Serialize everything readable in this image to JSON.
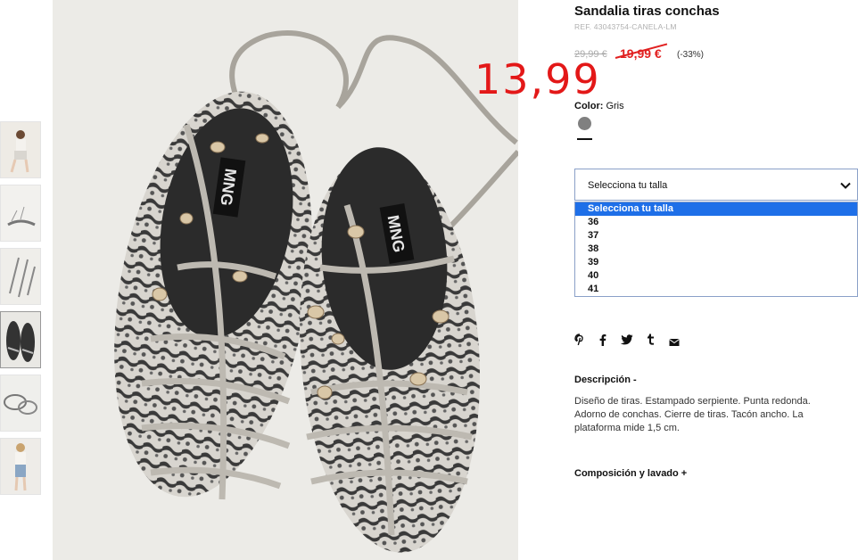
{
  "product": {
    "title": "Sandalia tiras conchas",
    "ref": "REF. 43043754-CANELA-LM",
    "old_price": "29,99 €",
    "sale_price": "19,99 €",
    "discount": "(-33%)",
    "handwritten_price": "13,99",
    "color_label": "Color:",
    "color_value": "Gris",
    "swatch_color": "#808080",
    "sale_color": "#e12020"
  },
  "size_select": {
    "label": "Selecciona tu talla",
    "options": [
      "Selecciona tu talla",
      "36",
      "37",
      "38",
      "39",
      "40",
      "41"
    ],
    "selected_index": 0
  },
  "share_icons": [
    "pinterest-icon",
    "facebook-icon",
    "twitter-icon",
    "tumblr-icon",
    "email-icon"
  ],
  "description": {
    "title": "Descripción -",
    "text": "Diseño de tiras. Estampado serpiente. Punta redonda. Adorno de conchas. Cierre de tiras. Tacón ancho. La plataforma mide 1,5 cm."
  },
  "composition": {
    "title": "Composición y lavado +"
  },
  "image": {
    "brand_text": "MNG"
  },
  "thumbnails": [
    "model-standing",
    "sandal-side",
    "sandal-top",
    "sandal-pair",
    "sandal-detail",
    "model-full"
  ]
}
